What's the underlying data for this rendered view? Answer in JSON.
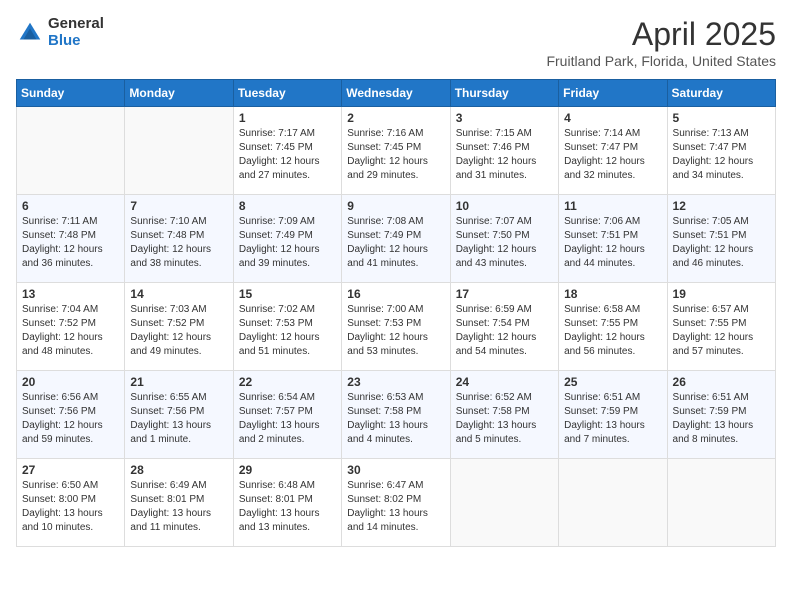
{
  "logo": {
    "general": "General",
    "blue": "Blue"
  },
  "title": "April 2025",
  "location": "Fruitland Park, Florida, United States",
  "weekdays": [
    "Sunday",
    "Monday",
    "Tuesday",
    "Wednesday",
    "Thursday",
    "Friday",
    "Saturday"
  ],
  "weeks": [
    [
      {
        "day": "",
        "info": ""
      },
      {
        "day": "",
        "info": ""
      },
      {
        "day": "1",
        "sunrise": "Sunrise: 7:17 AM",
        "sunset": "Sunset: 7:45 PM",
        "daylight": "Daylight: 12 hours and 27 minutes."
      },
      {
        "day": "2",
        "sunrise": "Sunrise: 7:16 AM",
        "sunset": "Sunset: 7:45 PM",
        "daylight": "Daylight: 12 hours and 29 minutes."
      },
      {
        "day": "3",
        "sunrise": "Sunrise: 7:15 AM",
        "sunset": "Sunset: 7:46 PM",
        "daylight": "Daylight: 12 hours and 31 minutes."
      },
      {
        "day": "4",
        "sunrise": "Sunrise: 7:14 AM",
        "sunset": "Sunset: 7:47 PM",
        "daylight": "Daylight: 12 hours and 32 minutes."
      },
      {
        "day": "5",
        "sunrise": "Sunrise: 7:13 AM",
        "sunset": "Sunset: 7:47 PM",
        "daylight": "Daylight: 12 hours and 34 minutes."
      }
    ],
    [
      {
        "day": "6",
        "sunrise": "Sunrise: 7:11 AM",
        "sunset": "Sunset: 7:48 PM",
        "daylight": "Daylight: 12 hours and 36 minutes."
      },
      {
        "day": "7",
        "sunrise": "Sunrise: 7:10 AM",
        "sunset": "Sunset: 7:48 PM",
        "daylight": "Daylight: 12 hours and 38 minutes."
      },
      {
        "day": "8",
        "sunrise": "Sunrise: 7:09 AM",
        "sunset": "Sunset: 7:49 PM",
        "daylight": "Daylight: 12 hours and 39 minutes."
      },
      {
        "day": "9",
        "sunrise": "Sunrise: 7:08 AM",
        "sunset": "Sunset: 7:49 PM",
        "daylight": "Daylight: 12 hours and 41 minutes."
      },
      {
        "day": "10",
        "sunrise": "Sunrise: 7:07 AM",
        "sunset": "Sunset: 7:50 PM",
        "daylight": "Daylight: 12 hours and 43 minutes."
      },
      {
        "day": "11",
        "sunrise": "Sunrise: 7:06 AM",
        "sunset": "Sunset: 7:51 PM",
        "daylight": "Daylight: 12 hours and 44 minutes."
      },
      {
        "day": "12",
        "sunrise": "Sunrise: 7:05 AM",
        "sunset": "Sunset: 7:51 PM",
        "daylight": "Daylight: 12 hours and 46 minutes."
      }
    ],
    [
      {
        "day": "13",
        "sunrise": "Sunrise: 7:04 AM",
        "sunset": "Sunset: 7:52 PM",
        "daylight": "Daylight: 12 hours and 48 minutes."
      },
      {
        "day": "14",
        "sunrise": "Sunrise: 7:03 AM",
        "sunset": "Sunset: 7:52 PM",
        "daylight": "Daylight: 12 hours and 49 minutes."
      },
      {
        "day": "15",
        "sunrise": "Sunrise: 7:02 AM",
        "sunset": "Sunset: 7:53 PM",
        "daylight": "Daylight: 12 hours and 51 minutes."
      },
      {
        "day": "16",
        "sunrise": "Sunrise: 7:00 AM",
        "sunset": "Sunset: 7:53 PM",
        "daylight": "Daylight: 12 hours and 53 minutes."
      },
      {
        "day": "17",
        "sunrise": "Sunrise: 6:59 AM",
        "sunset": "Sunset: 7:54 PM",
        "daylight": "Daylight: 12 hours and 54 minutes."
      },
      {
        "day": "18",
        "sunrise": "Sunrise: 6:58 AM",
        "sunset": "Sunset: 7:55 PM",
        "daylight": "Daylight: 12 hours and 56 minutes."
      },
      {
        "day": "19",
        "sunrise": "Sunrise: 6:57 AM",
        "sunset": "Sunset: 7:55 PM",
        "daylight": "Daylight: 12 hours and 57 minutes."
      }
    ],
    [
      {
        "day": "20",
        "sunrise": "Sunrise: 6:56 AM",
        "sunset": "Sunset: 7:56 PM",
        "daylight": "Daylight: 12 hours and 59 minutes."
      },
      {
        "day": "21",
        "sunrise": "Sunrise: 6:55 AM",
        "sunset": "Sunset: 7:56 PM",
        "daylight": "Daylight: 13 hours and 1 minute."
      },
      {
        "day": "22",
        "sunrise": "Sunrise: 6:54 AM",
        "sunset": "Sunset: 7:57 PM",
        "daylight": "Daylight: 13 hours and 2 minutes."
      },
      {
        "day": "23",
        "sunrise": "Sunrise: 6:53 AM",
        "sunset": "Sunset: 7:58 PM",
        "daylight": "Daylight: 13 hours and 4 minutes."
      },
      {
        "day": "24",
        "sunrise": "Sunrise: 6:52 AM",
        "sunset": "Sunset: 7:58 PM",
        "daylight": "Daylight: 13 hours and 5 minutes."
      },
      {
        "day": "25",
        "sunrise": "Sunrise: 6:51 AM",
        "sunset": "Sunset: 7:59 PM",
        "daylight": "Daylight: 13 hours and 7 minutes."
      },
      {
        "day": "26",
        "sunrise": "Sunrise: 6:51 AM",
        "sunset": "Sunset: 7:59 PM",
        "daylight": "Daylight: 13 hours and 8 minutes."
      }
    ],
    [
      {
        "day": "27",
        "sunrise": "Sunrise: 6:50 AM",
        "sunset": "Sunset: 8:00 PM",
        "daylight": "Daylight: 13 hours and 10 minutes."
      },
      {
        "day": "28",
        "sunrise": "Sunrise: 6:49 AM",
        "sunset": "Sunset: 8:01 PM",
        "daylight": "Daylight: 13 hours and 11 minutes."
      },
      {
        "day": "29",
        "sunrise": "Sunrise: 6:48 AM",
        "sunset": "Sunset: 8:01 PM",
        "daylight": "Daylight: 13 hours and 13 minutes."
      },
      {
        "day": "30",
        "sunrise": "Sunrise: 6:47 AM",
        "sunset": "Sunset: 8:02 PM",
        "daylight": "Daylight: 13 hours and 14 minutes."
      },
      {
        "day": "",
        "info": ""
      },
      {
        "day": "",
        "info": ""
      },
      {
        "day": "",
        "info": ""
      }
    ]
  ]
}
